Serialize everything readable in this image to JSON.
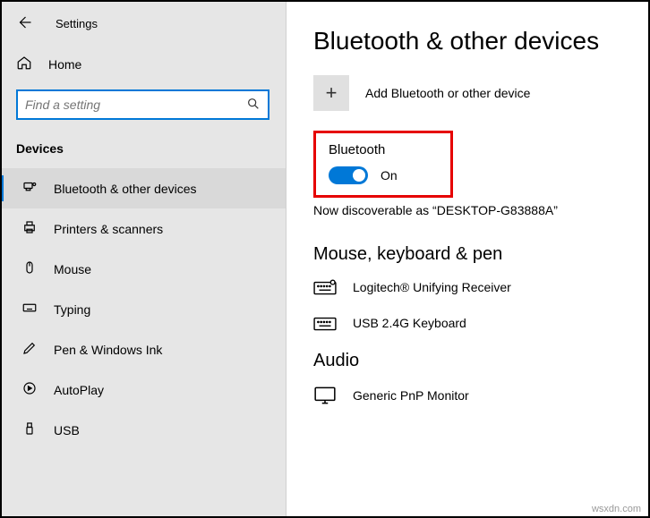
{
  "app_title": "Settings",
  "home_label": "Home",
  "search": {
    "placeholder": "Find a setting"
  },
  "section_header": "Devices",
  "nav": {
    "bluetooth": "Bluetooth & other devices",
    "printers": "Printers & scanners",
    "mouse": "Mouse",
    "typing": "Typing",
    "pen": "Pen & Windows Ink",
    "autoplay": "AutoPlay",
    "usb": "USB"
  },
  "main": {
    "title": "Bluetooth & other devices",
    "add_label": "Add Bluetooth or other device",
    "bluetooth_label": "Bluetooth",
    "toggle_state": "On",
    "discoverable": "Now discoverable as “DESKTOP-G83888A”",
    "sub_mouse": "Mouse, keyboard & pen",
    "device_unifying": "Logitech® Unifying Receiver",
    "device_usbkb": "USB 2.4G Keyboard",
    "sub_audio": "Audio",
    "device_monitor": "Generic PnP Monitor"
  },
  "watermark": "wsxdn.com"
}
